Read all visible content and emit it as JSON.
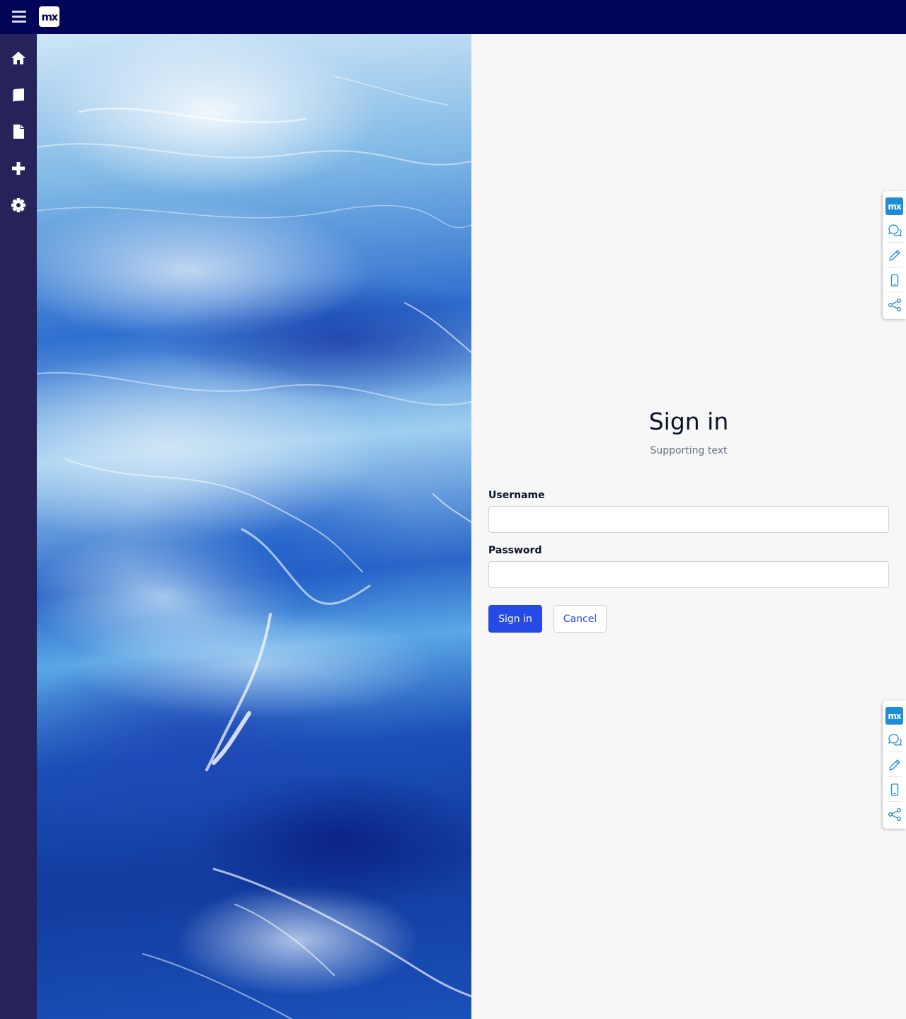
{
  "topbar": {
    "logo_text": "mx",
    "menu_icon": "hamburger-menu-icon",
    "background": "#020557"
  },
  "sidebar": {
    "background": "#252359",
    "items": [
      {
        "name": "home",
        "icon": "home-icon"
      },
      {
        "name": "book",
        "icon": "book-icon"
      },
      {
        "name": "page",
        "icon": "document-icon"
      },
      {
        "name": "add",
        "icon": "plus-icon"
      },
      {
        "name": "settings",
        "icon": "gear-icon"
      }
    ]
  },
  "hero": {
    "image": "ocean-waves-photo"
  },
  "signin": {
    "title": "Sign in",
    "subtitle": "Supporting text",
    "username_label": "Username",
    "username_value": "",
    "password_label": "Password",
    "password_value": "",
    "signin_button": "Sign in",
    "cancel_button": "Cancel",
    "accent": "#264ae5"
  },
  "dock": {
    "logo_text": "mx",
    "accent": "#1d8ed6",
    "items": [
      "chat-icon",
      "pencil-icon",
      "mobile-icon",
      "share-icon"
    ]
  }
}
